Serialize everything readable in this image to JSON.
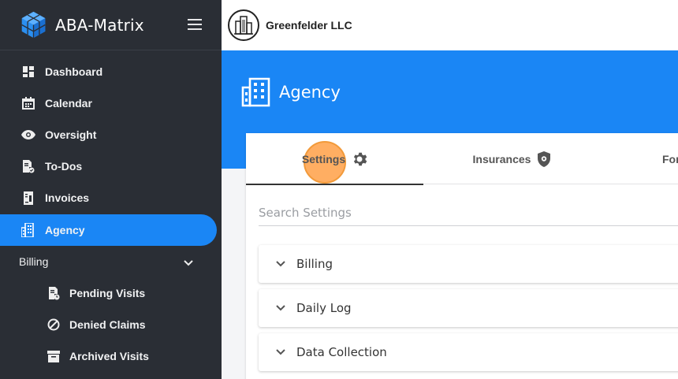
{
  "app": {
    "name": "ABA-Matrix"
  },
  "org": {
    "name": "Greenfelder LLC"
  },
  "page": {
    "title": "Agency"
  },
  "sidebar": {
    "items": [
      {
        "label": "Dashboard",
        "icon": "dashboard-icon"
      },
      {
        "label": "Calendar",
        "icon": "calendar-icon"
      },
      {
        "label": "Oversight",
        "icon": "eye-icon"
      },
      {
        "label": "To-Dos",
        "icon": "todo-icon"
      },
      {
        "label": "Invoices",
        "icon": "invoice-icon"
      },
      {
        "label": "Agency",
        "icon": "building-icon",
        "active": true
      }
    ],
    "group": {
      "label": "Billing",
      "icon": "chevron-down-icon"
    },
    "sub_items": [
      {
        "label": "Pending Visits",
        "icon": "pending-visits-icon"
      },
      {
        "label": "Denied Claims",
        "icon": "denied-icon"
      },
      {
        "label": "Archived Visits",
        "icon": "archive-icon"
      }
    ]
  },
  "tabs": [
    {
      "label": "Settings",
      "icon": "gear-icon",
      "active": true
    },
    {
      "label": "Insurances",
      "icon": "shield-icon"
    },
    {
      "label": "For",
      "icon": ""
    }
  ],
  "search": {
    "placeholder": "Search Settings"
  },
  "sections": [
    {
      "label": "Billing"
    },
    {
      "label": "Daily Log"
    },
    {
      "label": "Data Collection"
    }
  ],
  "colors": {
    "sidebar": "#2a2e35",
    "accent": "#1a86f5",
    "highlight": "#f29a3a"
  }
}
